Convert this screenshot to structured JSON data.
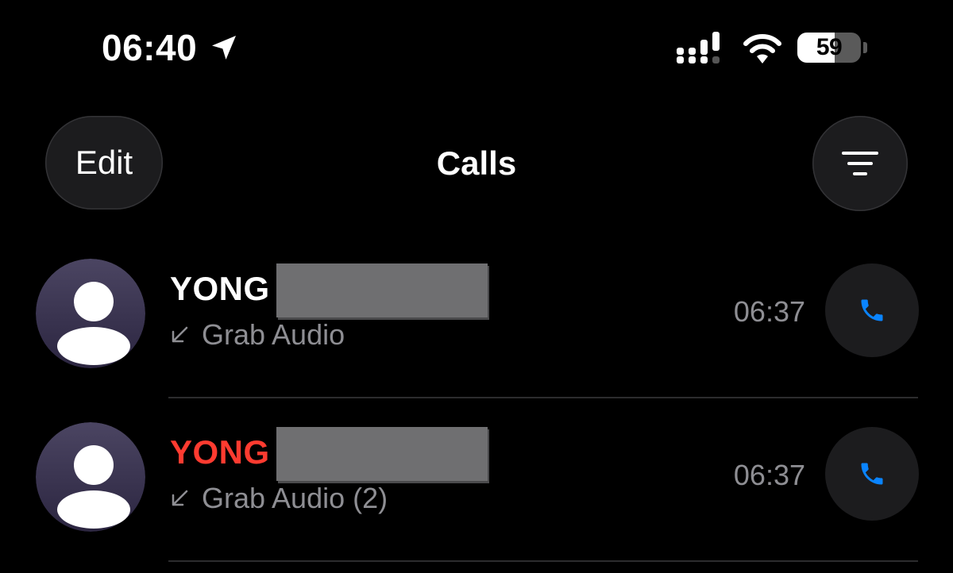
{
  "status_bar": {
    "time": "06:40",
    "location_icon": "location-arrow-icon",
    "signal_icon": "cellular-signal-icon",
    "wifi_icon": "wifi-icon",
    "battery_percent": "59",
    "battery_level": 0.59
  },
  "nav": {
    "edit_label": "Edit",
    "title": "Calls",
    "filter_icon": "filter-icon"
  },
  "calls": [
    {
      "name": "YONG",
      "name_color": "#ffffff",
      "type_icon": "incoming-call-arrow-icon",
      "subtitle": "Grab Audio",
      "time": "06:37"
    },
    {
      "name": "YONG",
      "name_color": "#ff3b30",
      "type_icon": "incoming-call-arrow-icon",
      "subtitle": "Grab Audio (2)",
      "time": "06:37"
    }
  ],
  "colors": {
    "background": "#000000",
    "button_bg": "#1c1c1e",
    "secondary_text": "#8e8e93",
    "accent_blue": "#0a84ff",
    "missed_red": "#ff3b30"
  }
}
